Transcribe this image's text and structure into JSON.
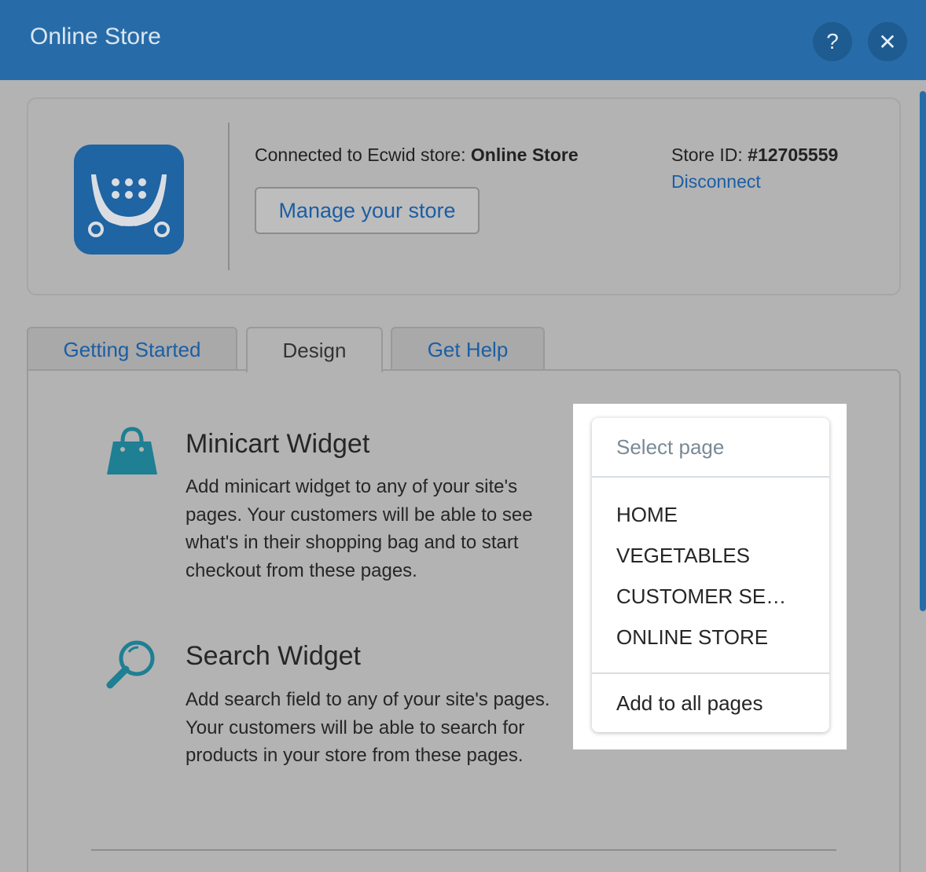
{
  "window": {
    "title": "Online Store",
    "help_label": "?",
    "close_label": "✕"
  },
  "store": {
    "connected_prefix": "Connected to Ecwid store: ",
    "store_name": "Online Store",
    "manage_label": "Manage your store",
    "store_id_prefix": "Store ID: ",
    "store_id": "#12705559",
    "disconnect_label": "Disconnect"
  },
  "tabs": [
    {
      "label": "Getting Started",
      "active": false
    },
    {
      "label": "Design",
      "active": true
    },
    {
      "label": "Get Help",
      "active": false
    }
  ],
  "widgets": [
    {
      "title": "Minicart Widget",
      "description": "Add minicart widget to any of your site's pages. Your customers will be able to see what's in their shopping bag and to start checkout from these pages.",
      "icon": "shopping-bag-icon"
    },
    {
      "title": "Search Widget",
      "description": "Add search field to any of your site's pages. Your customers will be able to search for products in your store from these pages.",
      "icon": "magnifier-icon"
    }
  ],
  "dropdown": {
    "header": "Select page",
    "items": [
      "HOME",
      "VEGETABLES",
      "CUSTOMER SE…",
      "ONLINE STORE"
    ],
    "footer": "Add to all pages"
  },
  "colors": {
    "titlebar": "#276ca8",
    "link": "#1b5ea4",
    "icon_teal": "#1f7f93",
    "logo_blue": "#1f64a3"
  }
}
